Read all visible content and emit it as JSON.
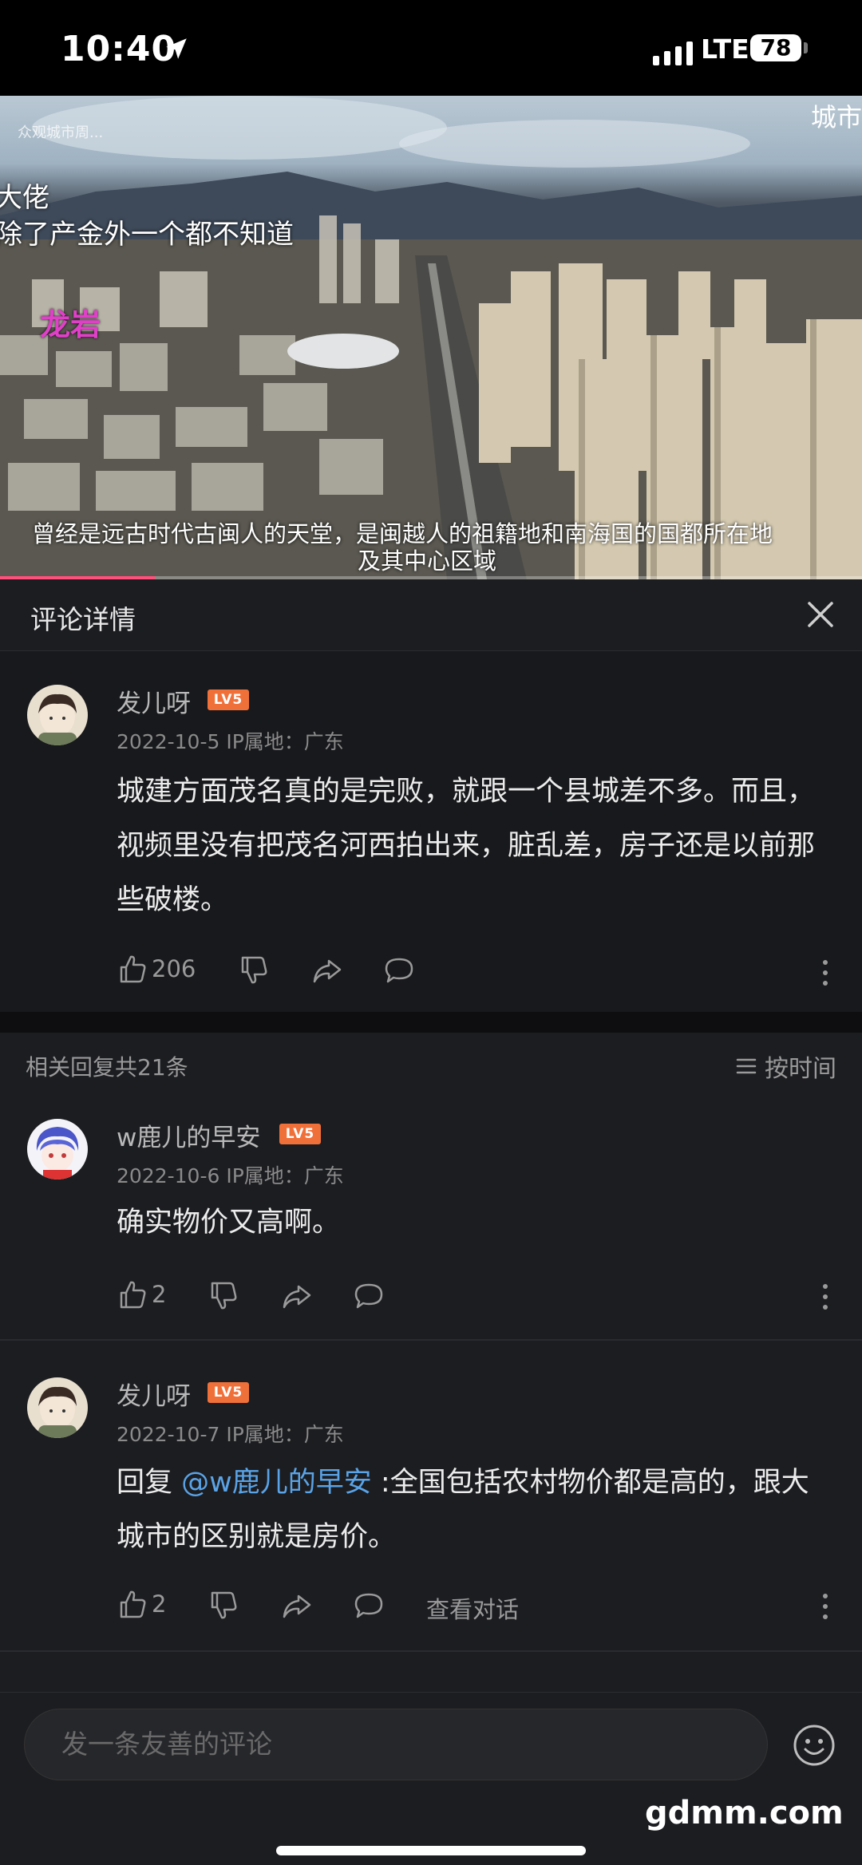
{
  "status_bar": {
    "time": "10:40",
    "network": "LTE",
    "battery": "78"
  },
  "video": {
    "watermark": "众观城市周...",
    "right_cut": "城市",
    "overlay_line1": "大佬",
    "overlay_line2": "除了产金外一个都不知道",
    "city_label": "龙岩",
    "subtitle_line1": "曾经是远古时代古闽人的天堂，是闽越人的祖籍地和南海国的国都所在地",
    "subtitle_line2": "及其中心区域",
    "progress": 0.18
  },
  "header": {
    "title": "评论详情"
  },
  "main_comment": {
    "username": "发儿呀",
    "level": "LV5",
    "date": "2022-10-5",
    "ip": "IP属地：广东",
    "text": "城建方面茂名真的是完败，就跟一个县城差不多。而且，视频里没有把茂名河西拍出来，脏乱差，房子还是以前那些破楼。",
    "likes": "206"
  },
  "replies_header": {
    "count": "相关回复共21条",
    "sort": "按时间"
  },
  "replies": [
    {
      "username": "w鹿儿的早安",
      "level": "LV5",
      "date": "2022-10-6",
      "ip": "IP属地：广东",
      "text": "确实物价又高啊。",
      "likes": "2"
    },
    {
      "username": "发儿呀",
      "level": "LV5",
      "date": "2022-10-7",
      "ip": "IP属地：广东",
      "reply_prefix": "回复 ",
      "mention": "@w鹿儿的早安",
      "text": " :全国包括农村物价都是高的，跟大城市的区别就是房价。",
      "likes": "2",
      "view_conversation": "查看对话"
    }
  ],
  "comment_input": {
    "placeholder": "发一条友善的评论"
  },
  "watermark": "gdmm.com"
}
